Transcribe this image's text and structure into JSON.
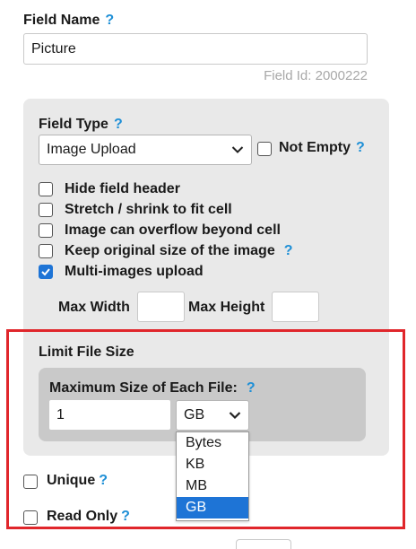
{
  "field_name": {
    "label": "Field Name",
    "help": "?",
    "value": "Picture",
    "field_id": "Field Id: 2000222"
  },
  "field_type": {
    "label": "Field Type",
    "help": "?",
    "selected": "Image Upload",
    "not_empty_label": "Not Empty",
    "not_empty_help": "?",
    "not_empty_checked": false
  },
  "options": [
    {
      "label": "Hide field header",
      "checked": false
    },
    {
      "label": "Stretch / shrink to fit cell",
      "checked": false
    },
    {
      "label": "Image can overflow beyond cell",
      "checked": false
    },
    {
      "label": "Keep original size of the image",
      "checked": false,
      "help": "?"
    },
    {
      "label": "Multi-images upload",
      "checked": true
    }
  ],
  "max_width_label": "Max Width",
  "max_height_label": "Max Height",
  "max_width_value": "",
  "max_height_value": "",
  "limit_file_size": {
    "title": "Limit File Size",
    "max_size_label": "Maximum Size of Each File:",
    "help": "?",
    "size_value": "1",
    "unit_selected": "GB",
    "unit_options": [
      "Bytes",
      "KB",
      "MB",
      "GB"
    ]
  },
  "unique": {
    "label": "Unique",
    "help": "?",
    "checked": false
  },
  "read_only": {
    "label": "Read Only",
    "help": "?",
    "checked": false
  },
  "colors": {
    "accent": "#1e74d6",
    "help": "#1e8fd6",
    "highlight_border": "#e0262b",
    "panel": "#e9e9e9",
    "inner_panel": "#c9c9c9"
  }
}
